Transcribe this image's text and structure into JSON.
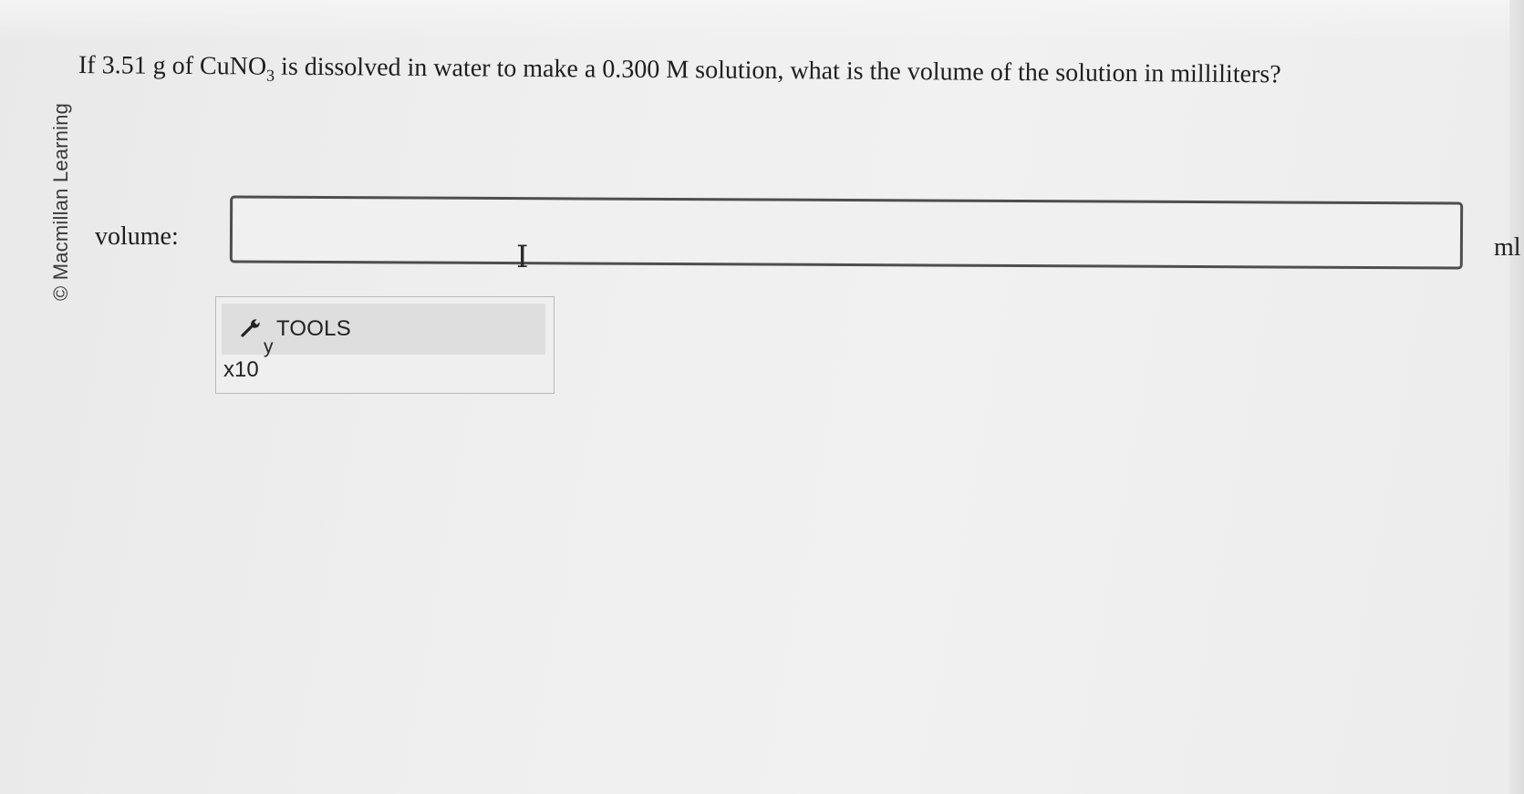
{
  "credit": "© Macmillan Learning",
  "question": {
    "prefix": "If 3.51 g of CuNO",
    "subscript": "3",
    "suffix": " is dissolved in water to make a 0.300 M solution, what is the volume of the solution in milliliters?"
  },
  "answer": {
    "label": "volume:",
    "value": "",
    "unit": "ml"
  },
  "tools": {
    "label": "TOOLS",
    "superscript_label": "y",
    "x10_label": "x10",
    "icon": "wrench-icon"
  },
  "colors": {
    "background": "#efefef",
    "input_border": "#4e4e4e",
    "panel_header": "#dedede"
  }
}
